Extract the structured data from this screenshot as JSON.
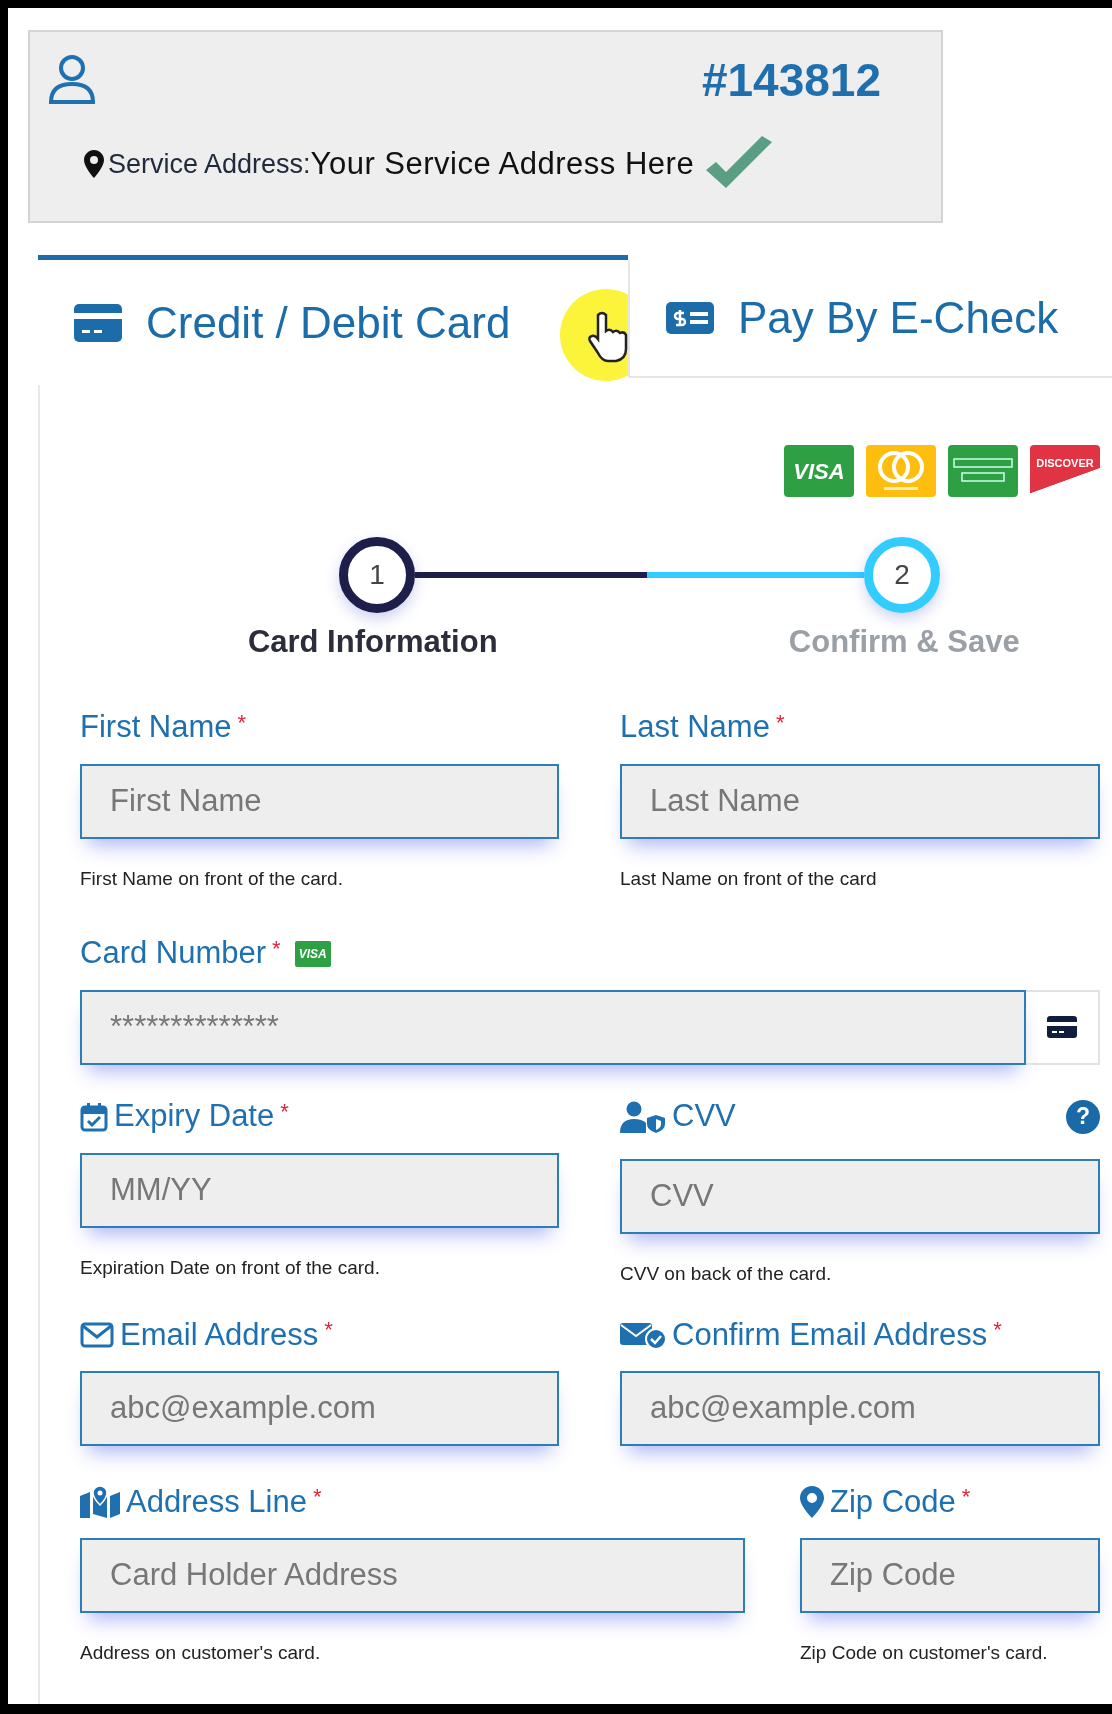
{
  "account": {
    "number": "#143812",
    "address_label": "Service Address:",
    "address": "Your Service Address Here",
    "verified": true
  },
  "tabs": [
    {
      "label": "Credit / Debit Card",
      "selected": true
    },
    {
      "label": "Pay By E-Check",
      "selected": false
    }
  ],
  "card_logos": [
    {
      "kind": "visa",
      "label": "VISA"
    },
    {
      "kind": "mastercard"
    },
    {
      "kind": "amex"
    },
    {
      "kind": "discover",
      "label": "DISCOVER"
    }
  ],
  "steps": [
    {
      "number": "1",
      "label": "Card Information",
      "active": true
    },
    {
      "number": "2",
      "label": "Confirm & Save",
      "active": false
    }
  ],
  "fields": [
    {
      "kind": "first-name",
      "label": "First Name",
      "required_mark": "*",
      "placeholder": "First Name",
      "help": "First Name on front of the card."
    },
    {
      "kind": "last-name",
      "label": "Last Name",
      "required_mark": "*",
      "placeholder": "Last Name",
      "help": "Last Name on front of the card"
    },
    {
      "kind": "card-number",
      "label": "Card Number",
      "required_mark": "*",
      "badge": "VISA",
      "placeholder": "**************"
    },
    {
      "kind": "expiry",
      "label": "Expiry Date",
      "required_mark": "*",
      "placeholder": "MM/YY",
      "help": "Expiration Date on front of the card."
    },
    {
      "kind": "cvv",
      "label": "CVV",
      "tip": "?",
      "placeholder": "CVV",
      "help": "CVV on back of the card."
    },
    {
      "kind": "email",
      "label": "Email Address",
      "required_mark": "*",
      "placeholder": "abc@example.com"
    },
    {
      "kind": "confirm-email",
      "label": "Confirm Email Address",
      "required_mark": "*",
      "placeholder": "abc@example.com"
    },
    {
      "kind": "address",
      "label": "Address Line",
      "required_mark": "*",
      "placeholder": "Card Holder Address",
      "help": "Address on customer's card."
    },
    {
      "kind": "zip",
      "label": "Zip Code",
      "required_mark": "*",
      "placeholder": "Zip Code",
      "help": "Zip Code on customer's card."
    }
  ]
}
